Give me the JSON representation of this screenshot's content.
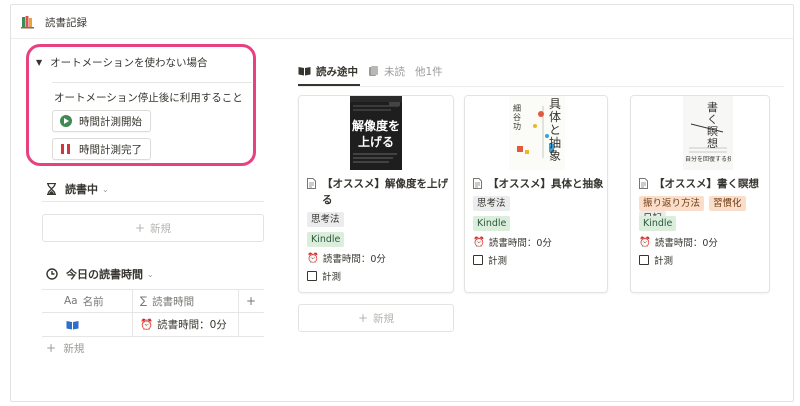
{
  "app": {
    "title": "読書記録",
    "icon": "books-icon"
  },
  "callout": {
    "toggle_label": "オートメーションを使わない場合",
    "paragraph": "オートメーション停止後に利用すること",
    "start_button": "時間計測開始",
    "stop_button": "時間計測完了",
    "border_color": "#e8417f"
  },
  "reading_section": {
    "title": "読書中",
    "new_label": "新規"
  },
  "today_section": {
    "title": "今日の読書時間",
    "columns": {
      "name": "名前",
      "total": "読書時間",
      "name_prefix": "Aa",
      "total_prefix": "∑"
    },
    "row": {
      "value": "読書時間：0分"
    },
    "add_row": "新規"
  },
  "tabs": [
    {
      "label": "読み途中",
      "active": true
    },
    {
      "label": "未読",
      "active": false
    },
    {
      "label": "他1件",
      "active": false
    }
  ],
  "cards": [
    {
      "title": "【オススメ】解像度を上げる",
      "cover_title": "解像度を上げる",
      "tags_row1": [
        "思考法"
      ],
      "tags_row2": [
        "Kindle"
      ],
      "reading_time": "読書時間：0分",
      "measure_label": "計測"
    },
    {
      "title": "【オススメ】具体と抽象",
      "cover_title": "具体と抽象",
      "cover_author": "細谷 功",
      "tags_row1": [
        "思考法"
      ],
      "tags_row2": [
        "Kindle"
      ],
      "reading_time": "読書時間：0分",
      "measure_label": "計測"
    },
    {
      "title": "【オススメ】書く瞑想",
      "cover_title": "書く瞑想",
      "cover_sub": "自分を回復する技術",
      "tags_row1": [
        "振り返り方法",
        "習慣化",
        "日記"
      ],
      "tags_row2": [
        "Kindle"
      ],
      "reading_time": "読書時間：0分",
      "measure_label": "計測"
    }
  ],
  "gallery_new": "新規"
}
